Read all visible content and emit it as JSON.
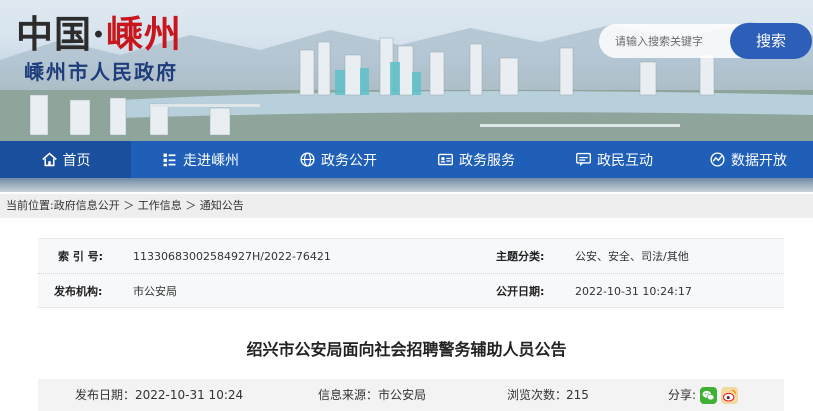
{
  "header": {
    "logo_part1": "中国·",
    "logo_part2": "嵊州",
    "subtitle": "嵊州市人民政府",
    "search": {
      "placeholder": "请输入搜索关键字",
      "button_label": "搜索"
    }
  },
  "nav": {
    "items": [
      {
        "label": "首页",
        "icon": "home-icon"
      },
      {
        "label": "走进嵊州",
        "icon": "list-icon"
      },
      {
        "label": "政务公开",
        "icon": "globe-icon"
      },
      {
        "label": "政务服务",
        "icon": "id-card-icon"
      },
      {
        "label": "政民互动",
        "icon": "chat-icon"
      },
      {
        "label": "数据开放",
        "icon": "database-icon"
      }
    ],
    "active_index": 0
  },
  "breadcrumb": {
    "prefix": "当前位置:",
    "items": [
      "政府信息公开",
      "工作信息",
      "通知公告"
    ],
    "separator": "＞"
  },
  "info": {
    "index_label": "索 引 号:",
    "index_value": "11330683002584927H/2022-76421",
    "category_label": "主题分类:",
    "category_value": "公安、安全、司法/其他",
    "publisher_label": "发布机构:",
    "publisher_value": "市公安局",
    "date_label": "公开日期:",
    "date_value": "2022-10-31 10:24:17"
  },
  "article": {
    "title": "绍兴市公安局面向社会招聘警务辅助人员公告"
  },
  "meta": {
    "publish_date": "发布日期：2022-10-31 10:24",
    "source": "信息来源：市公安局",
    "views_label": "浏览次数：",
    "views": "215",
    "share_label": "分享:"
  },
  "colors": {
    "nav_bg": "#1f5fb8",
    "search_button": "#2e5fb8",
    "logo_red": "#c8161d",
    "subtitle_blue": "#1e3d7a"
  }
}
